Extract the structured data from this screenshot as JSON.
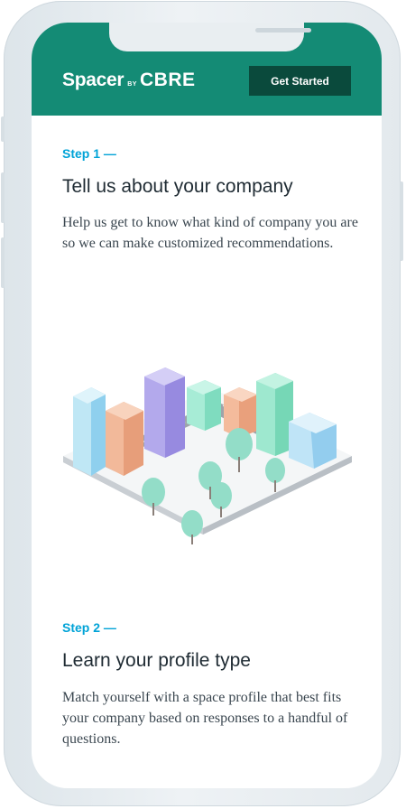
{
  "header": {
    "logo_main": "Spacer",
    "logo_by": "BY",
    "logo_brand": "CBRE",
    "cta_label": "Get Started",
    "color": "#148b75"
  },
  "steps": [
    {
      "label": "Step 1 —",
      "title": "Tell us about your company",
      "body": "Help us get to know what kind of company you are so we can make customized recommendations."
    },
    {
      "label": "Step 2 —",
      "title": "Learn your profile type",
      "body": "Match yourself with a space profile that best fits your company based on responses to a handful of questions."
    }
  ],
  "colors": {
    "accent": "#00a3d7",
    "button": "#0a4a3c"
  },
  "icons": [
    "city-illustration"
  ]
}
